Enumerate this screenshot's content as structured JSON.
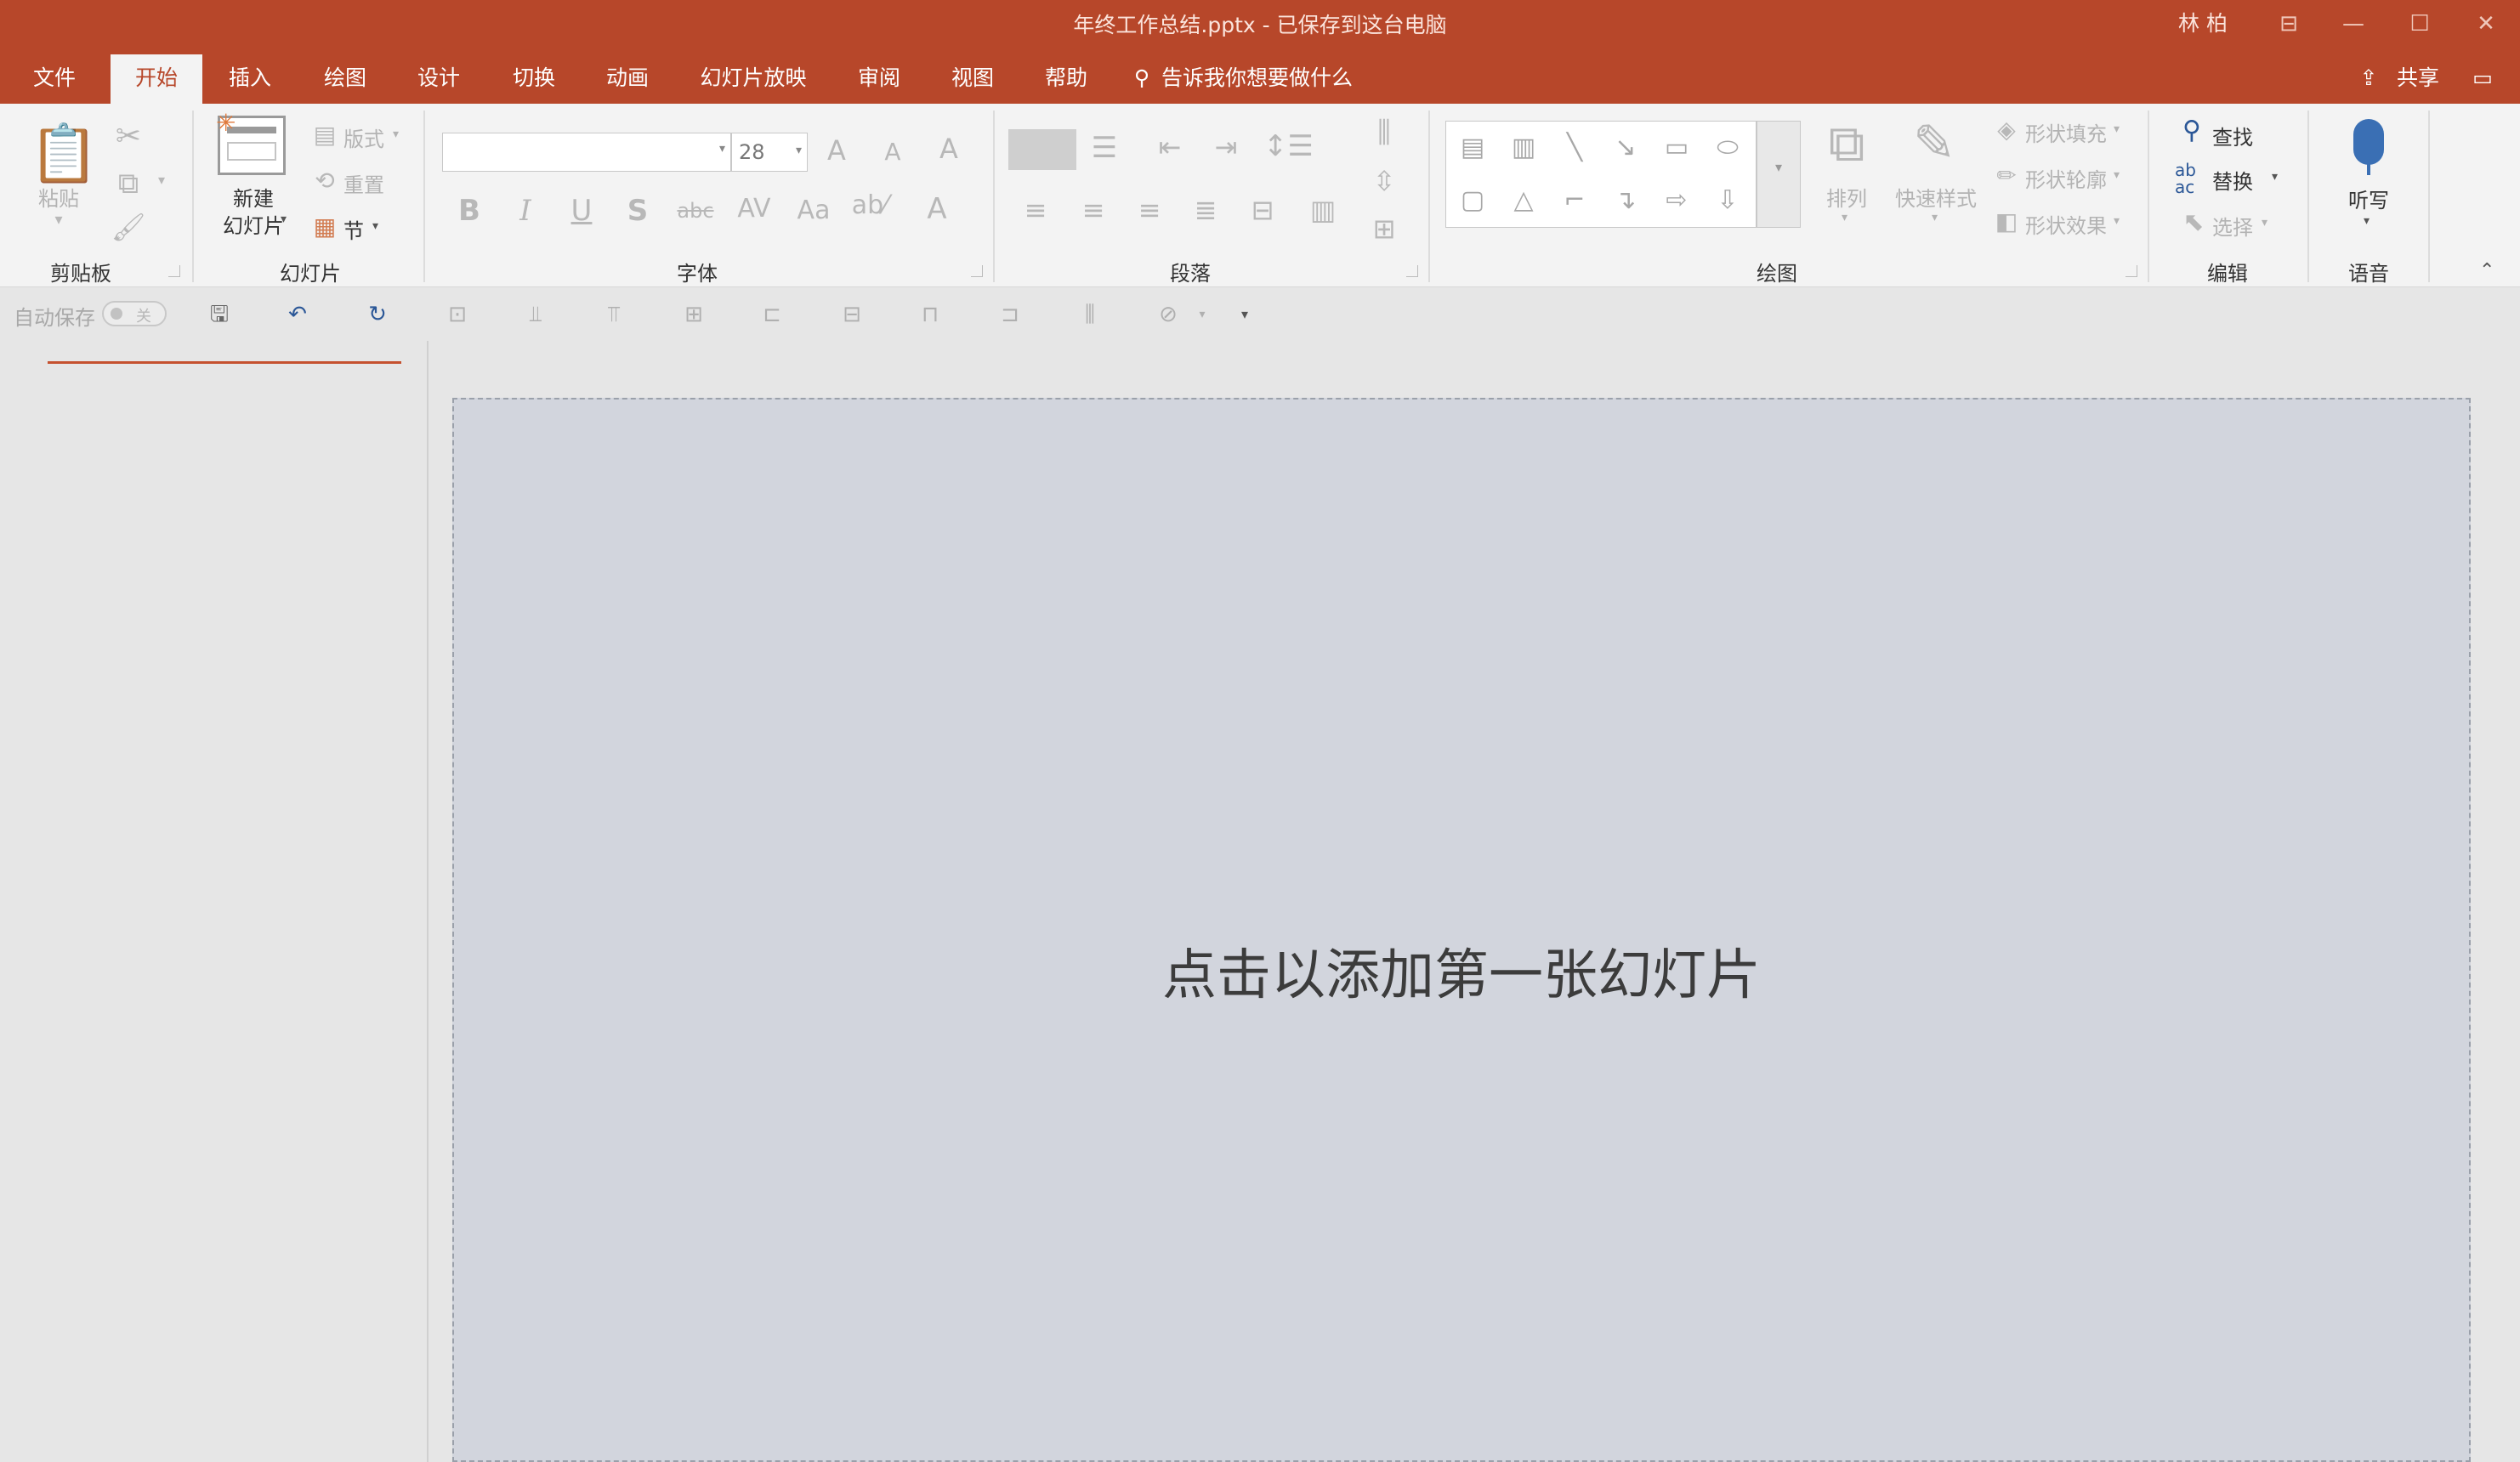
{
  "window": {
    "title": "年终工作总结.pptx  -  已保存到这台电脑",
    "user": "林 柏"
  },
  "tabs": [
    "文件",
    "开始",
    "插入",
    "绘图",
    "设计",
    "切换",
    "动画",
    "幻灯片放映",
    "审阅",
    "视图",
    "帮助"
  ],
  "tell_me": "告诉我你想要做什么",
  "share": "共享",
  "clipboard": {
    "paste": "粘贴",
    "group": "剪贴板"
  },
  "slides": {
    "new_line1": "新建",
    "new_line2": "幻灯片",
    "layout": "版式",
    "reset": "重置",
    "section": "节",
    "group": "幻灯片"
  },
  "font": {
    "name": "",
    "size": "28",
    "group": "字体",
    "change_case": "Aa"
  },
  "paragraph": {
    "group": "段落"
  },
  "drawing": {
    "arrange": "排列",
    "quick_styles": "快速样式",
    "fill": "形状填充",
    "outline": "形状轮廓",
    "effects": "形状效果",
    "group": "绘图"
  },
  "editing": {
    "find": "查找",
    "replace": "替换",
    "select": "选择",
    "group": "编辑"
  },
  "voice": {
    "dictate": "听写",
    "group": "语音"
  },
  "qat": {
    "autosave": "自动保存",
    "toggle": "关"
  },
  "slide": {
    "placeholder": "点击以添加第一张幻灯片"
  },
  "colors": {
    "accent": "#b7472a",
    "ribbon_bg": "#f3f3f3",
    "slide_bg": "#d2d5dd"
  }
}
